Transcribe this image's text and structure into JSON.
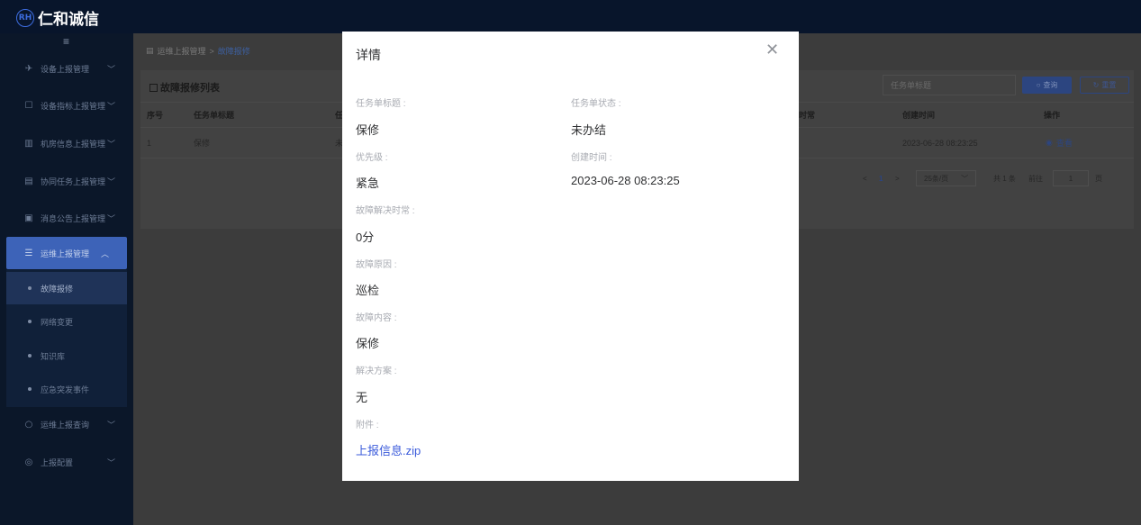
{
  "app": {
    "logo_mark": "RH",
    "title": "仁和诚信"
  },
  "sidebar": {
    "hamburger": "≡",
    "items": [
      {
        "label": "设备上报管理",
        "icon": "✈",
        "chevron": "﹀"
      },
      {
        "label": "设备指标上报管理",
        "icon": "☐",
        "chevron": "﹀"
      },
      {
        "label": "机房信息上报管理",
        "icon": "▥",
        "chevron": "﹀"
      },
      {
        "label": "协同任务上报管理",
        "icon": "▤",
        "chevron": "﹀"
      },
      {
        "label": "消息公告上报管理",
        "icon": "▣",
        "chevron": "﹀"
      },
      {
        "label": "运维上报管理",
        "icon": "☰",
        "chevron": "︿"
      }
    ],
    "subitems": [
      {
        "label": "故障报修"
      },
      {
        "label": "网络变更"
      },
      {
        "label": "知识库"
      },
      {
        "label": "应急突发事件"
      }
    ],
    "bottom_items": [
      {
        "label": "运维上报查询",
        "icon": "○",
        "chevron": "﹀"
      },
      {
        "label": "上报配置",
        "icon": "◎",
        "chevron": "﹀"
      }
    ]
  },
  "breadcrumb": {
    "root": "运维上报管理",
    "sep": ">",
    "current": "故障报修"
  },
  "list": {
    "title": "故障报修列表",
    "search_placeholder": "任务单标题",
    "query_label": "查询",
    "reset_label": "重置",
    "columns": [
      "序号",
      "任务单标题",
      "任",
      "时常",
      "创建时间",
      "操作"
    ],
    "rows": [
      {
        "index": "1",
        "title": "保修",
        "partial": "未",
        "created": "2023-06-28 08:23:25",
        "action": "查看"
      }
    ],
    "pager": {
      "prev": "<",
      "page": "1",
      "next": ">",
      "size": "25条/页",
      "total": "共 1 条",
      "goto": "前往",
      "goto_value": "1",
      "page_unit": "页"
    }
  },
  "modal": {
    "title": "详情",
    "close": "✕",
    "fields": {
      "task_title_label": "任务单标题 :",
      "task_title_value": "保修",
      "task_status_label": "任务单状态 :",
      "task_status_value": "未办结",
      "priority_label": "优先级 :",
      "priority_value": "紧急",
      "created_label": "创建时间 :",
      "created_value": "2023-06-28 08:23:25",
      "resolve_time_label": "故障解决时常 :",
      "resolve_time_value": "0分",
      "reason_label": "故障原因 :",
      "reason_value": "巡检",
      "content_label": "故障内容 :",
      "content_value": "保修",
      "solution_label": "解决方案 :",
      "solution_value": "无",
      "attachment_label": "附件 :",
      "attachment_value": "上报信息.zip"
    }
  }
}
